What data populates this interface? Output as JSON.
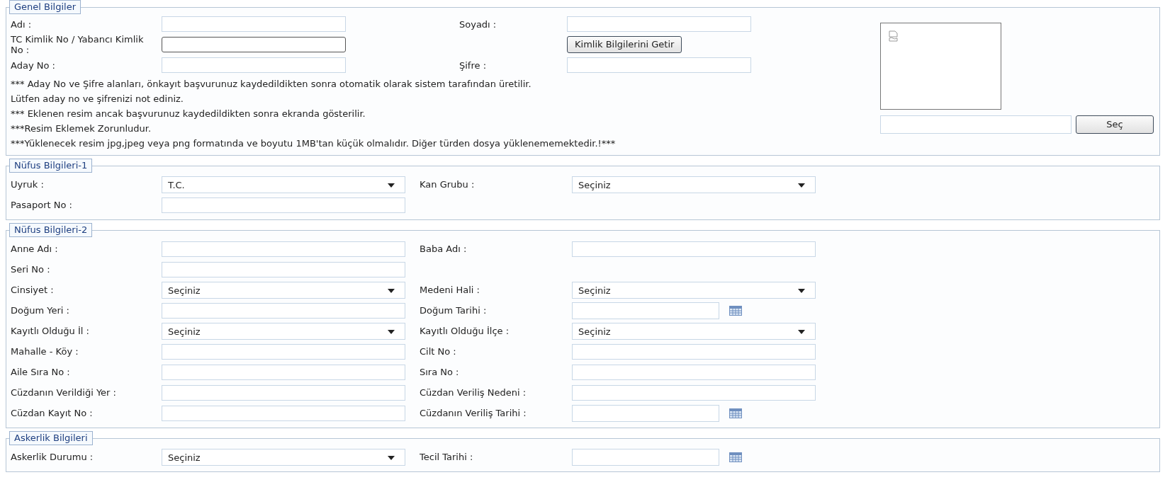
{
  "general": {
    "title": "Genel Bilgiler",
    "rows": [
      {
        "cells": [
          {
            "label": "Adı :",
            "kind": "text",
            "focused": false
          },
          {
            "label": "Soyadı :",
            "kind": "text",
            "focused": false
          }
        ]
      },
      {
        "cells": [
          {
            "label": "TC Kimlik No / Yabancı Kimlik No :",
            "kind": "text",
            "focused": true
          },
          {
            "kind": "button",
            "text": "Kimlik Bilgilerini Getir"
          }
        ]
      },
      {
        "cells": [
          {
            "label": "Aday No :",
            "kind": "text",
            "focused": false
          },
          {
            "label": "Şifre :",
            "kind": "text",
            "focused": false
          }
        ]
      }
    ],
    "notes": [
      "*** Aday No ve Şifre alanları, önkayıt başvurunuz kaydedildikten sonra otomatik olarak sistem tarafından üretilir.",
      "Lütfen aday no ve şifrenizi not ediniz.",
      "*** Eklenen resim ancak başvurunuz kaydedildikten sonra ekranda gösterilir.",
      "***Resim Eklemek Zorunludur.",
      "***Yüklenecek resim jpg,jpeg veya png formatında ve boyutu 1MB'tan küçük olmalıdır. Diğer türden dosya yüklenememektedir.!***"
    ],
    "photo": {
      "button": "Seç"
    }
  },
  "sections": [
    {
      "title": "Nüfus Bilgileri-1",
      "rows": [
        {
          "cells": [
            {
              "label": "Uyruk :",
              "kind": "select",
              "value": "T.C."
            },
            {
              "label": "Kan Grubu :",
              "kind": "select",
              "value": "Seçiniz"
            }
          ]
        },
        {
          "cells": [
            {
              "label": "Pasaport No :",
              "kind": "text"
            }
          ]
        }
      ]
    },
    {
      "title": "Nüfus Bilgileri-2",
      "rows": [
        {
          "cells": [
            {
              "label": "Anne Adı :",
              "kind": "text"
            },
            {
              "label": "Baba Adı :",
              "kind": "text"
            }
          ]
        },
        {
          "cells": [
            {
              "label": "Seri No :",
              "kind": "text"
            }
          ]
        },
        {
          "cells": [
            {
              "label": "Cinsiyet :",
              "kind": "select",
              "value": "Seçiniz"
            },
            {
              "label": "Medeni Hali :",
              "kind": "select",
              "value": "Seçiniz"
            }
          ]
        },
        {
          "cells": [
            {
              "label": "Doğum Yeri :",
              "kind": "text"
            },
            {
              "label": "Doğum Tarihi :",
              "kind": "date"
            }
          ]
        },
        {
          "cells": [
            {
              "label": "Kayıtlı Olduğu İl :",
              "kind": "select",
              "value": "Seçiniz"
            },
            {
              "label": "Kayıtlı Olduğu İlçe :",
              "kind": "select",
              "value": "Seçiniz"
            }
          ]
        },
        {
          "cells": [
            {
              "label": "Mahalle - Köy :",
              "kind": "text"
            },
            {
              "label": "Cilt No :",
              "kind": "text"
            }
          ]
        },
        {
          "cells": [
            {
              "label": "Aile Sıra No :",
              "kind": "text"
            },
            {
              "label": "Sıra No :",
              "kind": "text"
            }
          ]
        },
        {
          "cells": [
            {
              "label": "Cüzdanın Verildiği Yer :",
              "kind": "text"
            },
            {
              "label": "Cüzdan Veriliş Nedeni :",
              "kind": "text"
            }
          ]
        },
        {
          "cells": [
            {
              "label": "Cüzdan Kayıt No :",
              "kind": "text"
            },
            {
              "label": "Cüzdanın Veriliş Tarihi :",
              "kind": "date"
            }
          ]
        }
      ]
    },
    {
      "title": "Askerlik Bilgileri",
      "rows": [
        {
          "cells": [
            {
              "label": "Askerlik Durumu :",
              "kind": "select",
              "value": "Seçiniz"
            },
            {
              "label": "Tecil Tarihi :",
              "kind": "date"
            }
          ]
        }
      ]
    }
  ]
}
